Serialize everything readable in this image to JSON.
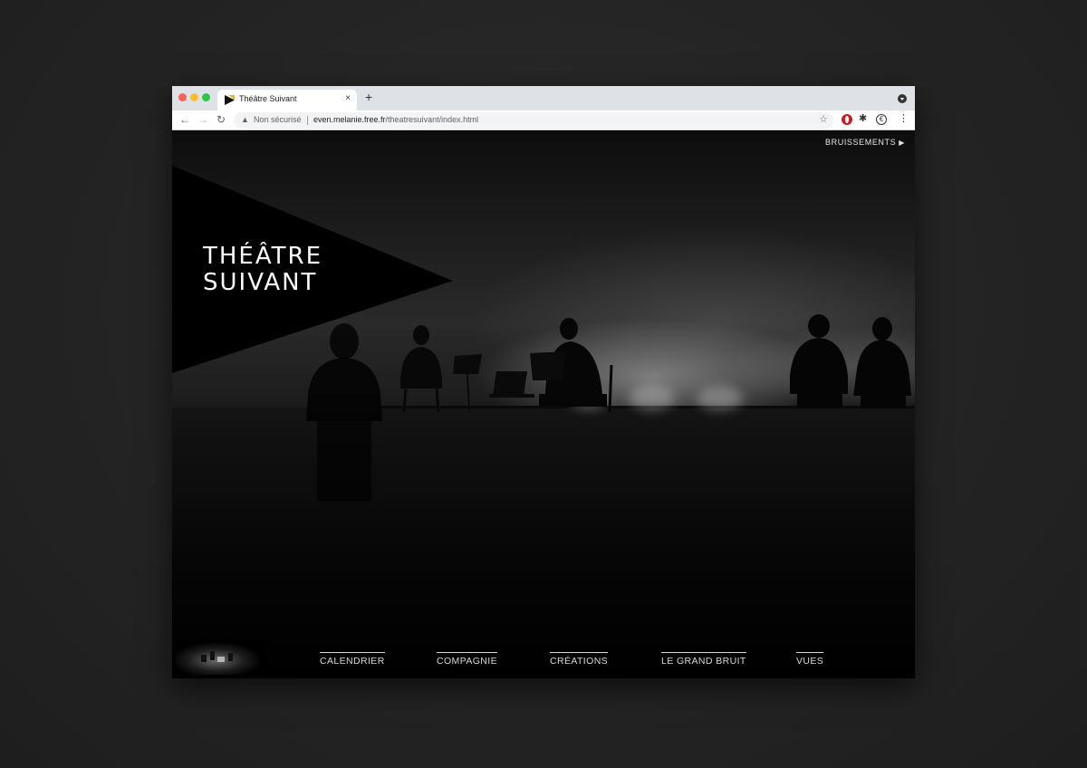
{
  "browser": {
    "tab_title": "Théâtre Suivant",
    "new_tab_label": "+",
    "close_label": "×",
    "security_label": "Non sécurisé",
    "url_host": "even.melanie.free.fr",
    "url_path": "/theatresuivant/index.html"
  },
  "site": {
    "logo_line1": "THÉÂTRE",
    "logo_line2": "SUIVANT",
    "bruissements_label": "BRUISSEMENTS",
    "nav": {
      "calendrier": "CALENDRIER",
      "compagnie": "COMPAGNIE",
      "creations": "CRÉATIONS",
      "grand_bruit": "LE GRAND BRUIT",
      "vues": "VUES"
    }
  },
  "colors": {
    "page_background": "#000000",
    "text": "#ffffff",
    "desk_background": "#262626"
  },
  "icons": [
    "back-arrow-icon",
    "forward-arrow-icon",
    "reload-icon",
    "warning-icon",
    "star-icon",
    "opera-icon",
    "puzzle-icon",
    "euro-icon",
    "menu-icon",
    "play-icon"
  ]
}
